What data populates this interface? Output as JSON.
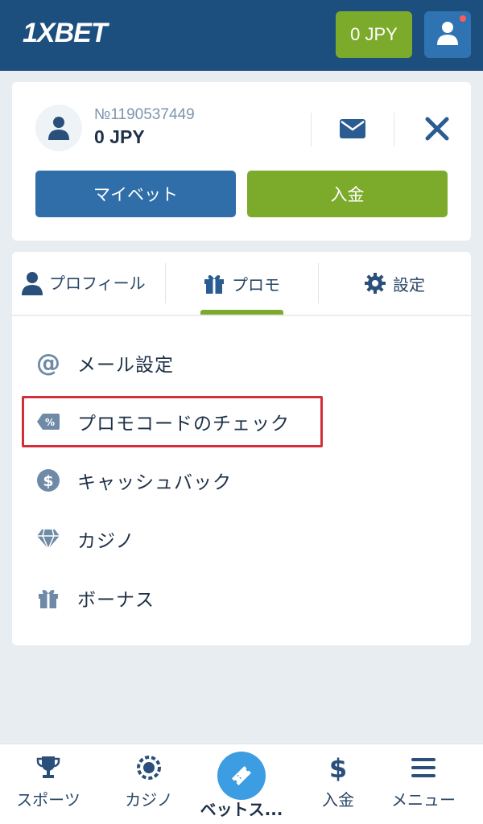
{
  "header": {
    "logo_text": "1XBET",
    "balance": "0 JPY"
  },
  "account": {
    "id": "№1190537449",
    "balance": "0 JPY",
    "my_bets_label": "マイベット",
    "deposit_label": "入金"
  },
  "tabs": [
    {
      "label": "プロフィール",
      "icon": "user-icon",
      "active": false
    },
    {
      "label": "プロモ",
      "icon": "gift-icon",
      "active": true
    },
    {
      "label": "設定",
      "icon": "gear-icon",
      "active": false
    }
  ],
  "promo_menu": [
    {
      "label": "メール設定",
      "icon": "at-icon"
    },
    {
      "label": "プロモコードのチェック",
      "icon": "coupon-icon"
    },
    {
      "label": "キャッシュバック",
      "icon": "dollar-coin-icon"
    },
    {
      "label": "カジノ",
      "icon": "diamond-icon"
    },
    {
      "label": "ボーナス",
      "icon": "gift-icon"
    }
  ],
  "bottom_nav": [
    {
      "label": "スポーツ",
      "icon": "trophy-icon"
    },
    {
      "label": "カジノ",
      "icon": "casino-chip-icon"
    },
    {
      "label": "ベットス...",
      "icon": "ticket-icon",
      "active": true
    },
    {
      "label": "入金",
      "icon": "dollar-icon"
    },
    {
      "label": "メニュー",
      "icon": "hamburger-icon"
    }
  ],
  "colors": {
    "header_bg": "#1c4f7e",
    "accent_green": "#7cab2c",
    "primary_blue": "#2f6ea9",
    "highlight_red": "#d32f3a",
    "active_nav_blue": "#3d9de2"
  }
}
